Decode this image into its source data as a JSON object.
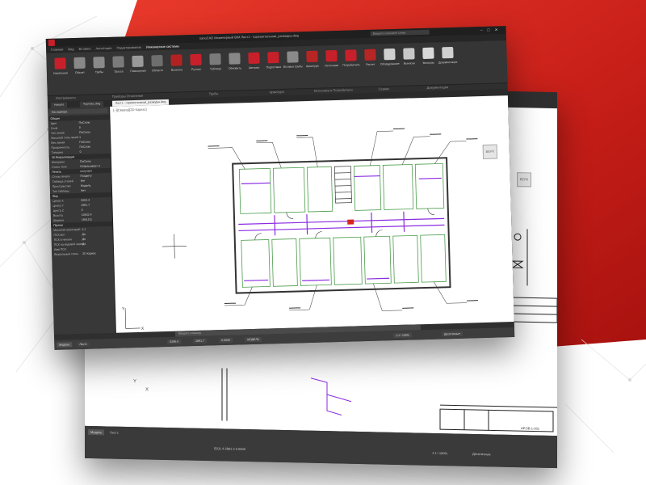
{
  "colors": {
    "accent_red": "#d8261d",
    "ribbon_dark": "#353535",
    "wall_green": "#4a9c4a",
    "pipe_purple": "#8a2be2"
  },
  "front_window": {
    "title": "nanoCAD Инженерный BIM  Лист1 - горизонтальная_разводка.dwg",
    "search_placeholder": "Введите ключевое слово",
    "menu": [
      "Главная",
      "Вид",
      "Вставка",
      "Аннотации",
      "Редактирование",
      "Инженерные системы"
    ],
    "ribbon_buttons": [
      {
        "label": "Начальная",
        "icon": "start-icon",
        "color": "#c8202a"
      },
      {
        "label": "Объект",
        "icon": "object-icon",
        "color": "#888888"
      },
      {
        "label": "Трубы",
        "icon": "pipes-icon",
        "color": "#8a8a8a"
      },
      {
        "label": "Трасса",
        "icon": "route-icon",
        "color": "#7a7a7a"
      },
      {
        "label": "Помещения",
        "icon": "rooms-icon",
        "color": "#999999"
      },
      {
        "label": "Области",
        "icon": "areas-icon",
        "color": "#6e6e6e"
      },
      {
        "label": "Выноска",
        "icon": "leader-icon",
        "color": "#b32222"
      },
      {
        "label": "Ручная",
        "icon": "hand-icon",
        "color": "#c8202a"
      },
      {
        "label": "Таблица",
        "icon": "table-icon",
        "color": "#7a7a7a"
      },
      {
        "label": "Обновить",
        "icon": "refresh-icon",
        "color": "#888888"
      },
      {
        "label": "Автомат.",
        "icon": "auto-icon",
        "color": "#c8202a"
      },
      {
        "label": "Подготовка",
        "icon": "prepare-icon",
        "color": "#c8202a"
      },
      {
        "label": "Вставка трубы",
        "icon": "insert-pipe-icon",
        "color": "#8a8a8a"
      },
      {
        "label": "Арматура",
        "icon": "valve-icon",
        "color": "#b82525"
      },
      {
        "label": "Источники",
        "icon": "source-icon",
        "color": "#c8202a"
      },
      {
        "label": "Потребители",
        "icon": "consumer-icon",
        "color": "#c8202a"
      },
      {
        "label": "Расчет",
        "icon": "calc-icon",
        "color": "#b82525"
      },
      {
        "label": "Оборудование",
        "icon": "equipment-icon",
        "color": "#d0d0d0"
      },
      {
        "label": "Выноски",
        "icon": "callouts-icon",
        "color": "#c8c8c8"
      },
      {
        "label": "Фильтры",
        "icon": "filters-icon",
        "color": "#d8d8d8"
      },
      {
        "label": "Документация",
        "icon": "docs-icon",
        "color": "#d0d0d0"
      }
    ],
    "ribbon_groups": [
      "Инструменты",
      "Приборы Отопления",
      "Трубы",
      "Арматура",
      "Источники и Потребители",
      "Сервис",
      "Документация"
    ],
    "tabs": [
      "Начало",
      "Чертеж1.dwg",
      "Лист1 - горизонтальная_разводка.dwg"
    ],
    "active_tab": "Лист1 - горизонтальная_разводка.dwg",
    "properties": {
      "header": "Без выбора",
      "sections": [
        {
          "name": "Общие",
          "rows": [
            {
              "k": "Цвет",
              "v": "ПоСлою"
            },
            {
              "k": "Слой",
              "v": "0"
            },
            {
              "k": "Тип линий",
              "v": "ПоСлою"
            },
            {
              "k": "Масштаб типа линий",
              "v": "1"
            },
            {
              "k": "Вес линий",
              "v": "ПоСлою"
            },
            {
              "k": "Прозрачность",
              "v": "ПоСлою"
            },
            {
              "k": "Толщина",
              "v": "0"
            }
          ]
        },
        {
          "name": "3D Визуализация",
          "rows": [
            {
              "k": "Материал",
              "v": "ПоСлою"
            },
            {
              "k": "Стиль тени",
              "v": "Отбрасывает и получает"
            }
          ]
        },
        {
          "name": "Печать",
          "rows": [
            {
              "k": "Стиль печати",
              "v": "ПоЦвету"
            },
            {
              "k": "Таблица стилей",
              "v": "Нет"
            },
            {
              "k": "Пространство",
              "v": "Модель"
            },
            {
              "k": "Тип таблицы",
              "v": "Нет"
            }
          ]
        },
        {
          "name": "Вид",
          "rows": [
            {
              "k": "Центр X",
              "v": "5203.4"
            },
            {
              "k": "Центр Y",
              "v": "2891.7"
            },
            {
              "k": "Центр Z",
              "v": "0"
            },
            {
              "k": "Высота",
              "v": "10632.4"
            },
            {
              "k": "Ширина",
              "v": "19410.5"
            }
          ]
        },
        {
          "name": "Прочее",
          "rows": [
            {
              "k": "Масштаб аннотаций",
              "v": "1:1"
            },
            {
              "k": "ПСК вкл",
              "v": "Да"
            },
            {
              "k": "ПСК в начале",
              "v": "Да"
            },
            {
              "k": "ПСК на видовой экран",
              "v": "Да"
            },
            {
              "k": "Имя ПСК",
              "v": ""
            },
            {
              "k": "Визуальный стиль",
              "v": "2D Каркас"
            }
          ]
        }
      ]
    },
    "drawing_header": "[–][Сверху][2D Каркас]",
    "viewcube_label": "ВЕРХ",
    "command_placeholder": "Введите команду",
    "status_tabs": [
      "Модель",
      "Лист1"
    ],
    "status_items": [
      "5296.4",
      "2891.7",
      "0.0000",
      "МОДЕЛЬ",
      "1:1 / 100%",
      "Десятичные"
    ]
  },
  "back_window": {
    "viewcube_label": "ВЕРХ",
    "status_tabs": [
      "Модель",
      "Лист1"
    ],
    "status_coords": "5201.4  2891.3  0.0000",
    "status_scale": "1:1 / 100%",
    "status_units": "Десятичные",
    "stamp_text": "АР.ОВ-1-001"
  }
}
